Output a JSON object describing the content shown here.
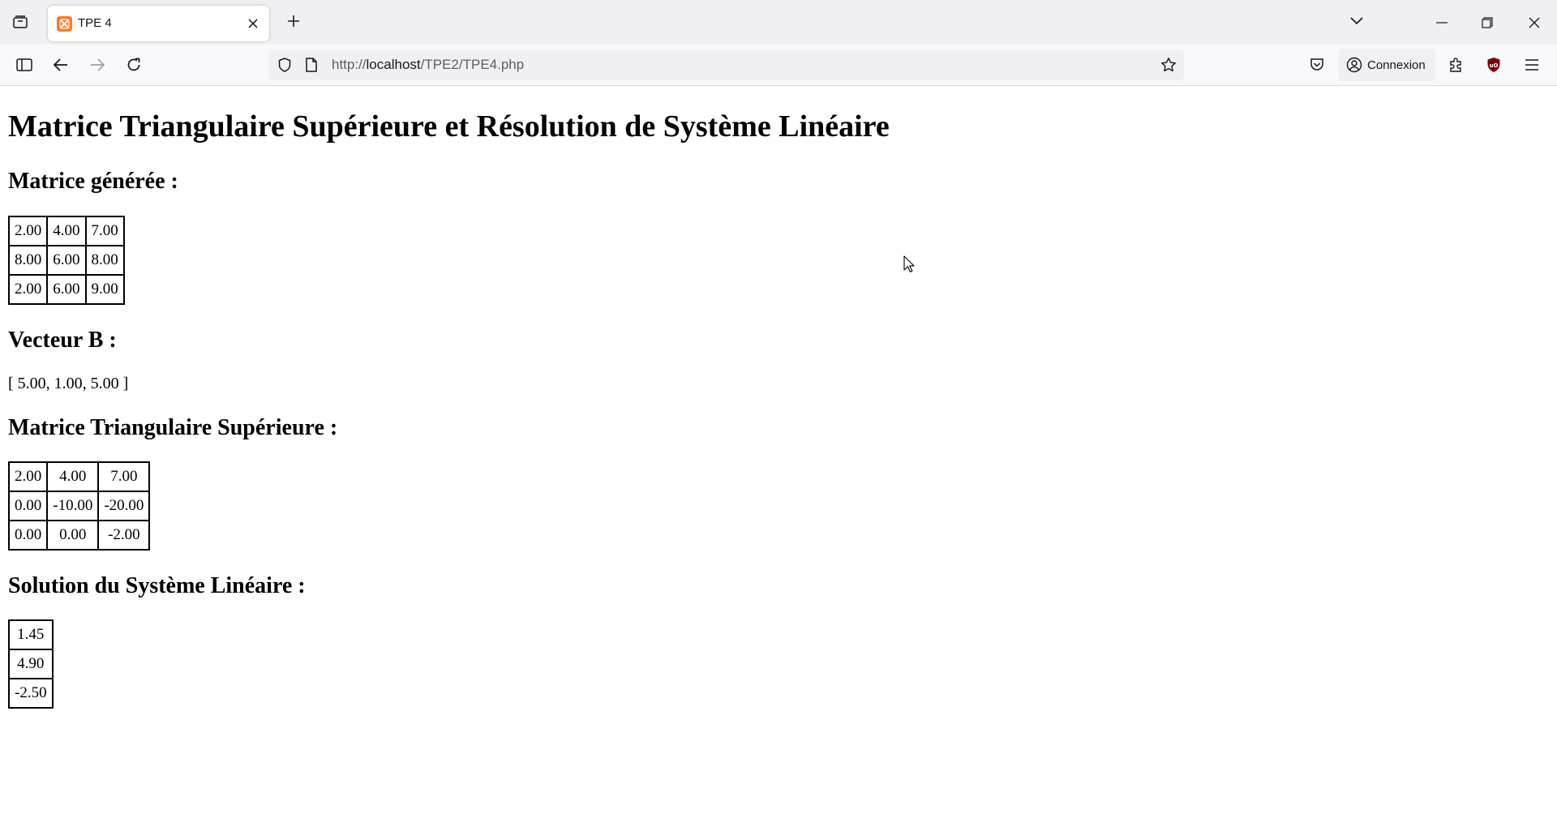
{
  "browser": {
    "tab": {
      "title": "TPE 4"
    },
    "url": {
      "scheme": "http://",
      "host": "localhost",
      "path": "/TPE2/TPE4.php"
    },
    "account_label": "Connexion"
  },
  "page": {
    "heading": "Matrice Triangulaire Supérieure et Résolution de Système Linéaire",
    "generated_matrix": {
      "title": "Matrice générée :",
      "rows": [
        [
          "2.00",
          "4.00",
          "7.00"
        ],
        [
          "8.00",
          "6.00",
          "8.00"
        ],
        [
          "2.00",
          "6.00",
          "9.00"
        ]
      ]
    },
    "vector_b": {
      "title": "Vecteur B :",
      "text": "[ 5.00, 1.00, 5.00 ]"
    },
    "upper_triangular": {
      "title": "Matrice Triangulaire Supérieure :",
      "rows": [
        [
          "2.00",
          "4.00",
          "7.00"
        ],
        [
          "0.00",
          "-10.00",
          "-20.00"
        ],
        [
          "0.00",
          "0.00",
          "-2.00"
        ]
      ]
    },
    "solution": {
      "title": "Solution du Système Linéaire :",
      "rows": [
        [
          "1.45"
        ],
        [
          "4.90"
        ],
        [
          "-2.50"
        ]
      ]
    }
  }
}
